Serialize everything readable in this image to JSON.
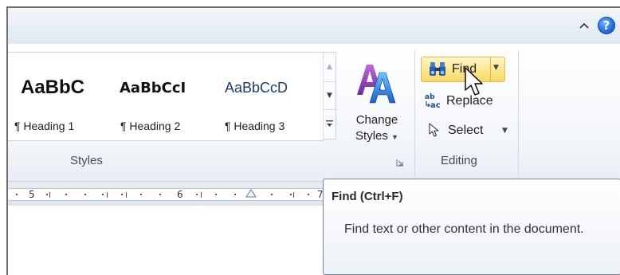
{
  "titlebar": {
    "collapse_icon": "chevron-up-icon",
    "help_icon": "help-icon",
    "help_glyph": "?"
  },
  "styles_gallery": {
    "items": [
      {
        "sample": "AaBbC",
        "name": "¶ Heading 1"
      },
      {
        "sample": "AaBbCcI",
        "name": "¶ Heading 2"
      },
      {
        "sample": "AaBbCcD",
        "name": "¶ Heading 3"
      }
    ],
    "group_label": "Styles"
  },
  "change_styles": {
    "line1": "Change",
    "line2": "Styles"
  },
  "editing": {
    "find_label": "Find",
    "replace_label": "Replace",
    "select_label": "Select",
    "group_label": "Editing"
  },
  "ruler": {
    "numbers": [
      "5",
      "6",
      "7"
    ]
  },
  "tooltip": {
    "title": "Find (Ctrl+F)",
    "description": "Find text or other content in the document."
  },
  "colors": {
    "find_highlight": "#fde68f",
    "help_blue": "#1c67d9",
    "ribbon_bg": "#f3f6fa"
  }
}
